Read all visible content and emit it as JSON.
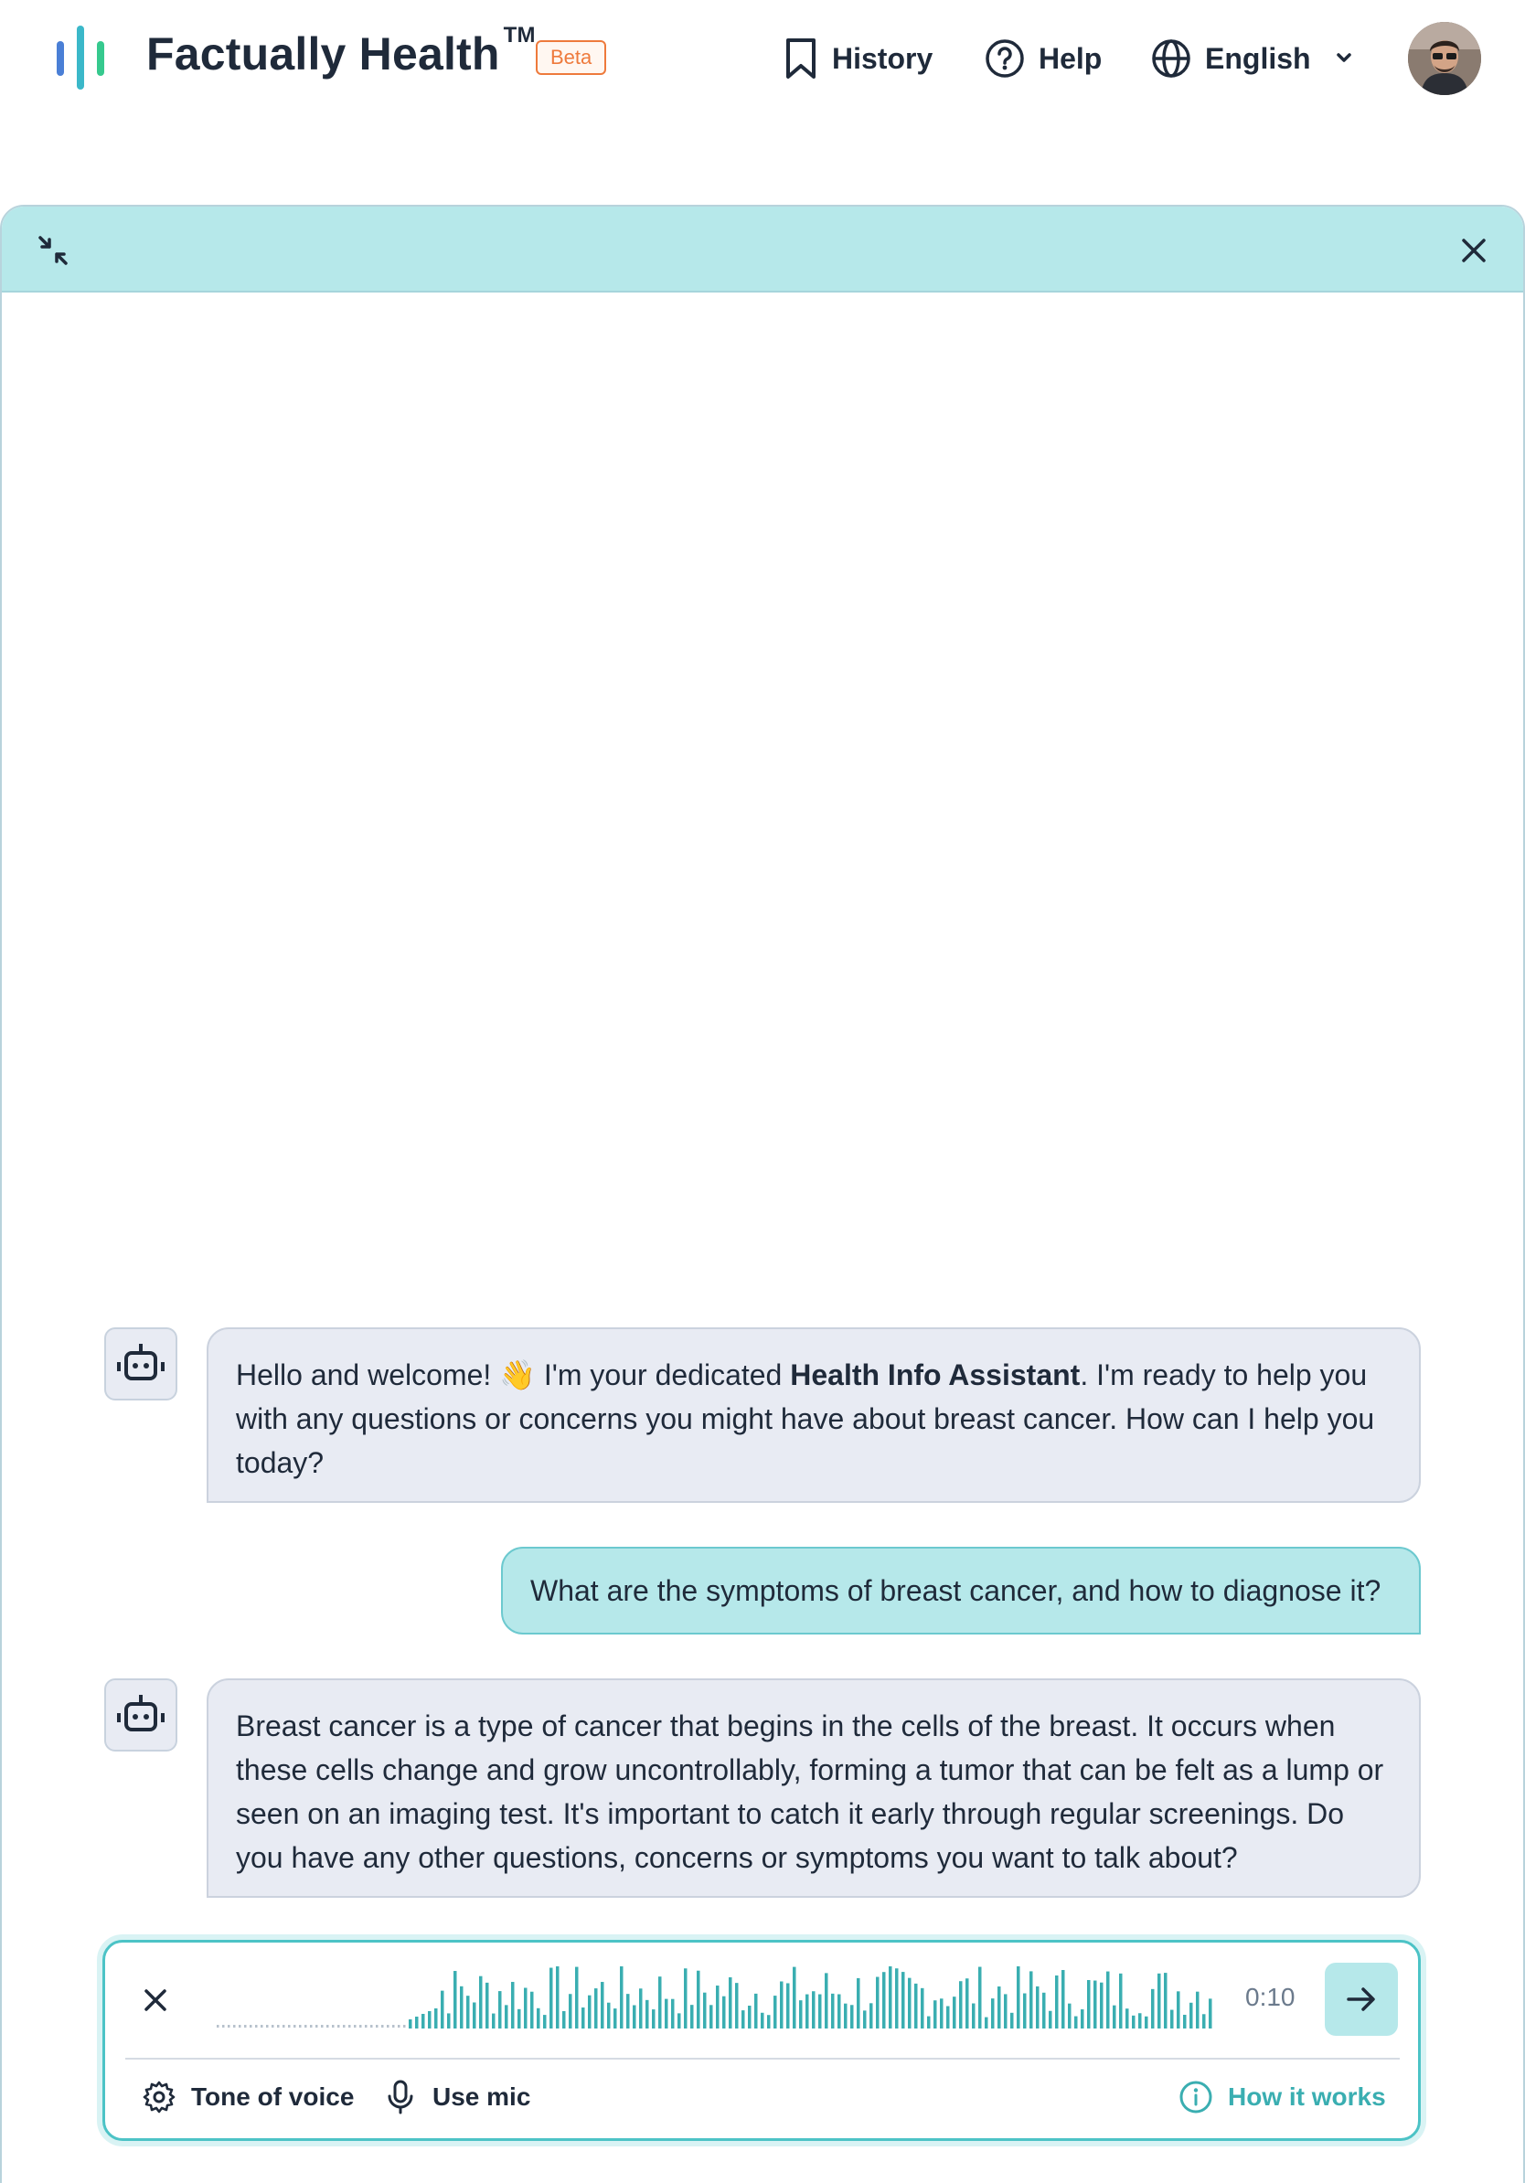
{
  "header": {
    "brand": "Factually Health",
    "trademark": "TM",
    "beta": "Beta",
    "nav": {
      "history": "History",
      "help": "Help",
      "language": "English"
    },
    "logo_colors": [
      "#4a7fd6",
      "#3bb8c9",
      "#36c98e"
    ]
  },
  "chat": {
    "messages": [
      {
        "role": "assistant",
        "text_before": "Hello and welcome! 👋 I'm your dedicated ",
        "text_bold": "Health Info Assistant",
        "text_after": ". I'm ready to help you with any questions or concerns you might have about breast cancer. How can I help you today?"
      },
      {
        "role": "user",
        "text": "What are the symptoms of breast cancer, and how to diagnose it?"
      },
      {
        "role": "assistant",
        "text": "Breast cancer is a type of cancer that begins in the cells of the breast. It occurs when these cells change and grow uncontrollably, forming a tumor that can be felt as a lump or seen on an imaging test. It's important to catch it early through regular screenings. Do you have any other questions, concerns or symptoms you want to talk about?"
      }
    ]
  },
  "composer": {
    "timer": "0:10",
    "tone_of_voice": "Tone of voice",
    "use_mic": "Use mic",
    "how_it_works": "How it works",
    "accent_color": "#3aaeb1"
  }
}
